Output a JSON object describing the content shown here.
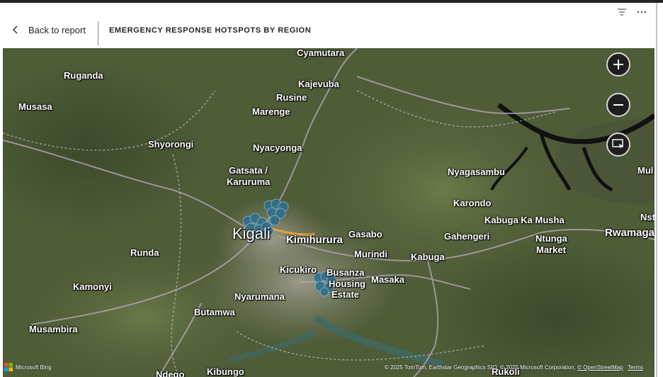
{
  "header": {
    "back_label": "Back to report",
    "title": "EMERGENCY RESPONSE HOTSPOTS BY REGION"
  },
  "toolbar": {
    "filter_icon": "filter-icon",
    "more_icon": "more-options-icon"
  },
  "map": {
    "labels": {
      "cyamutara": "Cyamutara",
      "ruganda": "Ruganda",
      "kajevuba": "Kajevuba",
      "musasa": "Musasa",
      "rusine": "Rusine",
      "marenge": "Marenge",
      "shyorongi": "Shyorongi",
      "nyacyonga": "Nyacyonga",
      "gatsata": "Gatsata /",
      "karuruma": "Karuruma",
      "nyagasambu": "Nyagasambu",
      "mul": "Mul",
      "karondo": "Karondo",
      "kabuga_ka_musha": "Kabuga Ka Musha",
      "nst": "Nst",
      "gasabo": "Gasabo",
      "gahengeri": "Gahengeri",
      "rwamaga": "Rwamaga",
      "kigali": "Kigali",
      "kimihurura": "Kimihurura",
      "ntunga": "Ntunga",
      "market": "Market",
      "runda": "Runda",
      "murindi": "Murindi",
      "kabuga": "Kabuga",
      "kicukiro": "Kicukiro",
      "busanza": "Busanza",
      "housing": "Housing",
      "estate": "Estate",
      "masaka": "Masaka",
      "kamonyi": "Kamonyi",
      "nyarumana": "Nyarumana",
      "butamwa": "Butamwa",
      "musambira": "Musambira",
      "ndego": "Ndego",
      "kibungo": "Kibungo",
      "rukoli": "Rukoli"
    },
    "controls": {
      "zoom_in_icon": "plus-icon",
      "zoom_out_icon": "minus-icon",
      "select_icon": "select-area-icon"
    },
    "logo_text": "Microsoft Bing",
    "attribution": {
      "text": "© 2025 TomTom, Earthstar Geographics SIO, © 2025 Microsoft Corporation, ",
      "osm_link": "© OpenStreetMap",
      "terms_link": "Terms"
    },
    "colors": {
      "hotspot": "#2e6e8c",
      "terrain": "#4d5a36"
    }
  }
}
